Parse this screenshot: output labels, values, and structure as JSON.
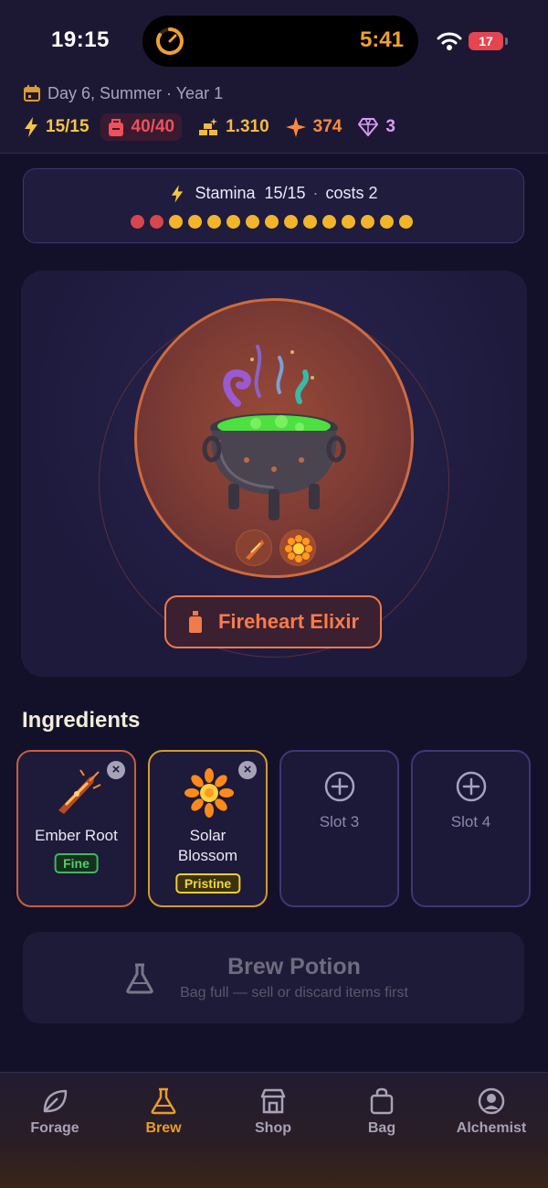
{
  "status_bar": {
    "time": "19:15",
    "live_activity_timer": "5:41",
    "battery_level": "17"
  },
  "header": {
    "date": "Day 6, Summer · Year 1",
    "stats": {
      "energy": "15/15",
      "bag": "40/40",
      "gold": "1.310",
      "sparks": "374",
      "gems": "3"
    }
  },
  "stamina": {
    "label": "Stamina",
    "value": "15/15",
    "separator": "·",
    "cost": "costs 2",
    "total": 15,
    "cost_count": 2
  },
  "cauldron": {
    "potion_name": "Fireheart Elixir",
    "icons": [
      "cauldron-icon",
      "ember-root-icon",
      "solar-blossom-icon",
      "potion-bottle-icon"
    ]
  },
  "ingredients": {
    "title": "Ingredients",
    "slots": [
      {
        "name": "Ember Root",
        "quality": "Fine",
        "color": "#c4603e"
      },
      {
        "name_line1": "Solar",
        "name_line2": "Blossom",
        "quality": "Pristine",
        "color": "#d49a2a"
      },
      {
        "label": "Slot 3"
      },
      {
        "label": "Slot 4"
      }
    ]
  },
  "brew": {
    "title": "Brew Potion",
    "subtitle": "Bag full — sell or discard items first"
  },
  "tabs": [
    {
      "label": "Forage",
      "icon": "leaf-icon"
    },
    {
      "label": "Brew",
      "icon": "flask-icon",
      "active": true
    },
    {
      "label": "Shop",
      "icon": "store-icon"
    },
    {
      "label": "Bag",
      "icon": "bag-icon"
    },
    {
      "label": "Alchemist",
      "icon": "profile-icon"
    }
  ],
  "colors": {
    "background": "#13112a",
    "accent": "#f07a4a",
    "energy": "#f5c542",
    "active_tab": "#e89c2a"
  }
}
